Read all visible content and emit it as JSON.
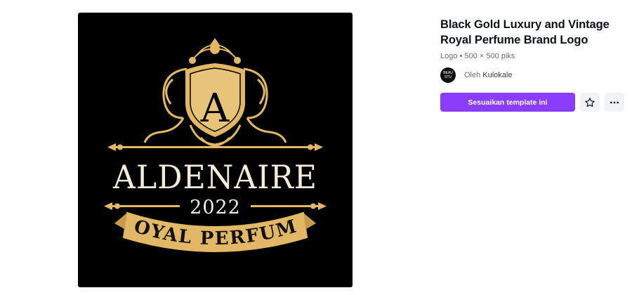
{
  "preview": {
    "logo": {
      "monogram": "A",
      "brand": "ALDENAIRE",
      "year": "2022",
      "ribbon": "ROYAL PERFUME"
    },
    "colors": {
      "background": "#000000",
      "gold": "#e2b866",
      "cream": "#f3ecd9"
    }
  },
  "details": {
    "title": "Black Gold Luxury and Vintage Royal Perfume Brand Logo",
    "meta": "Logo • 500 × 500 piks",
    "author_prefix": "Oleh",
    "author_name": "Kulokale",
    "avatar_text": "BEAU STU"
  },
  "actions": {
    "primary_label": "Sesuaikan template ini",
    "favorite_icon": "star-icon",
    "more_icon": "more-horizontal-icon"
  },
  "colors": {
    "accent": "#8b3dff",
    "icon_button_bg": "#f2f3f5"
  }
}
